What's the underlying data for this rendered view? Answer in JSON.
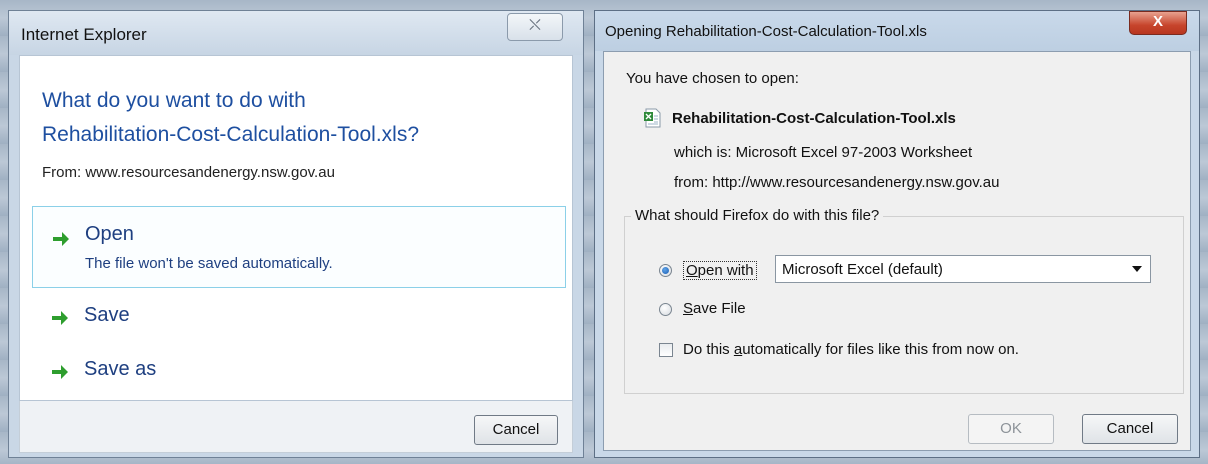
{
  "ie_dialog": {
    "title": "Internet Explorer",
    "close_glyph": "⛌",
    "question_line1": "What do you want to do with",
    "question_line2": "Rehabilitation-Cost-Calculation-Tool.xls?",
    "from": "From: www.resourcesandenergy.nsw.gov.au",
    "options": [
      {
        "label": "Open",
        "sub": "The file won't be saved automatically."
      },
      {
        "label": "Save"
      },
      {
        "label": "Save as"
      }
    ],
    "cancel_label": "Cancel",
    "arrow_color": "#2e9e2e"
  },
  "ff_dialog": {
    "title": "Opening Rehabilitation-Cost-Calculation-Tool.xls",
    "close_glyph": "X",
    "chosen_label": "You have chosen to open:",
    "file_name": "Rehabilitation-Cost-Calculation-Tool.xls",
    "which_is": "which is:  Microsoft Excel 97-2003 Worksheet",
    "from": "from:  http://www.resourcesandenergy.nsw.gov.au",
    "group_legend": "What should Firefox do with this file?",
    "open_with_label_pre": "",
    "open_with_accel": "O",
    "open_with_label_post": "pen with",
    "open_with_selected": true,
    "application": "Microsoft Excel (default)",
    "save_file_accel": "S",
    "save_file_post": "ave File",
    "auto_pre": "Do this ",
    "auto_accel": "a",
    "auto_post": "utomatically for files like this from now on.",
    "auto_checked": false,
    "ok_label": "OK",
    "ok_enabled": false,
    "cancel_label": "Cancel"
  }
}
